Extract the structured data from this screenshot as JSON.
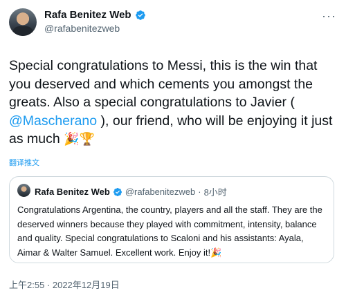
{
  "author": {
    "name": "Rafa Benitez Web",
    "handle": "@rafabenitezweb"
  },
  "tweet": {
    "text_part1": "Special congratulations to Messi, this is the win that you deserved and which cements you amongst the greats. Also a special congratulations to Javier (",
    "mention": "@Mascherano",
    "text_part2": "), our friend, who will be enjoying it just as much",
    "emojis": "🎉🏆",
    "translate_label": "翻译推文",
    "timestamp": "上午2:55 · 2022年12月19日"
  },
  "quoted_tweet": {
    "name": "Rafa Benitez Web",
    "handle": "@rafabenitezweb",
    "separator": "·",
    "time": "8小时",
    "text": "Congratulations Argentina, the country, players and all the staff. They are the deserved winners because they played with commitment, intensity, balance and quality. Special congratulations to Scaloni and his assistants: Ayala, Aimar & Walter Samuel. Excellent work. Enjoy it!",
    "emoji": "🎉"
  },
  "colors": {
    "accent": "#1d9bf0",
    "text": "#0f1419",
    "muted": "#536471",
    "border": "#cfd9de"
  },
  "icons": [
    "verified-badge-icon",
    "more-options-icon"
  ]
}
